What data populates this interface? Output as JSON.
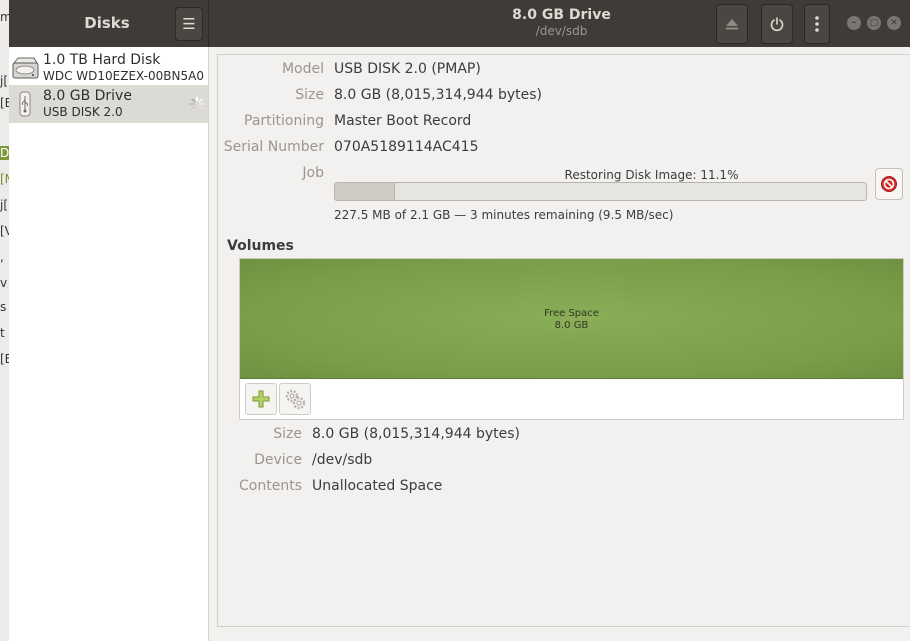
{
  "background_app": {
    "fragments": [
      "m",
      "j[",
      "[E",
      "D",
      "[M",
      "j[",
      "[V",
      ",",
      "v",
      "s",
      "t",
      "[E"
    ]
  },
  "header": {
    "sidebar_title": "Disks",
    "menu_icon": "hamburger-menu-icon",
    "title": "8.0 GB Drive",
    "subtitle": "/dev/sdb",
    "eject_icon": "eject-icon",
    "power_icon": "power-icon",
    "more_icon": "vertical-dots-icon",
    "window_controls": [
      "minimize",
      "maximize",
      "close"
    ]
  },
  "sidebar": {
    "drives": [
      {
        "name": "1.0 TB Hard Disk",
        "model": "WDC WD10EZEX-00BN5A0",
        "icon": "hard-disk-icon",
        "selected": false
      },
      {
        "name": "8.0 GB Drive",
        "model": "USB DISK 2.0",
        "icon": "usb-drive-icon",
        "selected": true,
        "busy": true
      }
    ]
  },
  "drive_info": {
    "model_label": "Model",
    "model_value": "USB DISK 2.0 (PMAP)",
    "size_label": "Size",
    "size_value": "8.0 GB (8,015,314,944 bytes)",
    "partitioning_label": "Partitioning",
    "partitioning_value": "Master Boot Record",
    "serial_label": "Serial Number",
    "serial_value": "070A5189114AC415",
    "job_label": "Job"
  },
  "job": {
    "title": "Restoring Disk Image: 11.1%",
    "progress_fraction": 0.111,
    "detail": "227.5 MB of 2.1 GB — 3 minutes remaining (9.5 MB/sec)",
    "cancel_icon": "cancel-icon"
  },
  "volumes": {
    "title": "Volumes",
    "free_space_name": "Free Space",
    "free_space_size": "8.0 GB",
    "add_icon": "add-partition-icon",
    "settings_icon": "gears-icon",
    "size_label": "Size",
    "size_value": "8.0 GB (8,015,314,944 bytes)",
    "device_label": "Device",
    "device_value": "/dev/sdb",
    "contents_label": "Contents",
    "contents_value": "Unallocated Space"
  },
  "colors": {
    "headerbar": "#3e3b38",
    "free_space": "#7b9c48",
    "selected_row": "#dcdad5",
    "cancel_red": "#d0302a"
  }
}
